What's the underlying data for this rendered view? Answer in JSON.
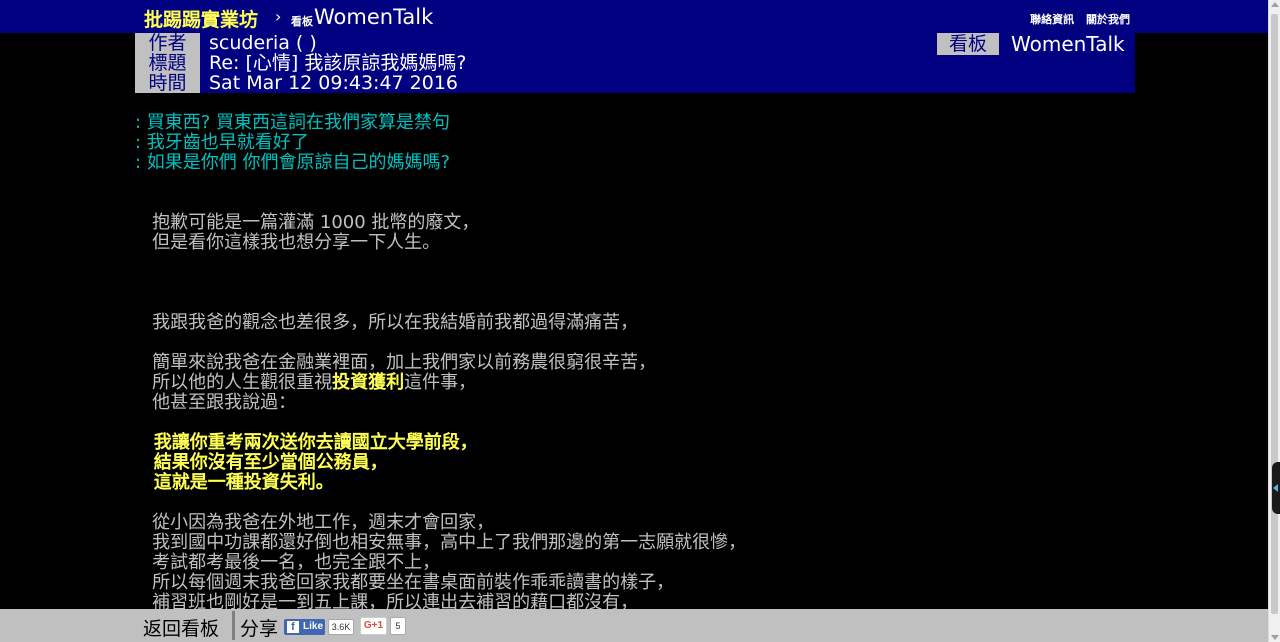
{
  "topbar": {
    "site_title": "批踢踢實業坊",
    "separator": "›",
    "board_small_label": "看板",
    "board_name": "WomenTalk",
    "links": [
      "聯絡資訊",
      "關於我們"
    ]
  },
  "article": {
    "meta": {
      "author_label": "作者",
      "author": "scuderia ( )",
      "title_label": "標題",
      "title": "Re: [心情] 我該原諒我媽媽嗎?",
      "time_label": "時間",
      "time": "Sat Mar 12 09:43:47 2016",
      "board_label": "看板",
      "board": "WomenTalk"
    },
    "lines": [
      {
        "type": "quote",
        "text": ": 買東西? 買東西這詞在我們家算是禁句"
      },
      {
        "type": "quote",
        "text": ": 我牙齒也早就看好了"
      },
      {
        "type": "quote",
        "text": ": 如果是你們 你們會原諒自己的媽媽嗎?"
      },
      {
        "type": "normal",
        "text": ""
      },
      {
        "type": "normal",
        "text": ""
      },
      {
        "type": "normal",
        "text": "   抱歉可能是一篇灌滿 1000 批幣的廢文，"
      },
      {
        "type": "normal",
        "text": "   但是看你這樣我也想分享一下人生。"
      },
      {
        "type": "normal",
        "text": ""
      },
      {
        "type": "normal",
        "text": ""
      },
      {
        "type": "normal",
        "text": ""
      },
      {
        "type": "normal",
        "text": "   我跟我爸的觀念也差很多，所以在我結婚前我都過得滿痛苦，"
      },
      {
        "type": "normal",
        "text": ""
      },
      {
        "type": "normal",
        "text": "   簡單來說我爸在金融業裡面，加上我們家以前務農很窮很辛苦，"
      },
      {
        "type": "mixed",
        "before": "   所以他的人生觀很重視",
        "highlight": "投資獲利",
        "after": "這件事，"
      },
      {
        "type": "normal",
        "text": "   他甚至跟我說過："
      },
      {
        "type": "normal",
        "text": ""
      },
      {
        "type": "highlight",
        "text": "   我讓你重考兩次送你去讀國立大學前段，"
      },
      {
        "type": "highlight",
        "text": "   結果你沒有至少當個公務員，"
      },
      {
        "type": "highlight",
        "text": "   這就是一種投資失利。"
      },
      {
        "type": "normal",
        "text": ""
      },
      {
        "type": "normal",
        "text": "   從小因為我爸在外地工作，週末才會回家，"
      },
      {
        "type": "normal",
        "text": "   我到國中功課都還好倒也相安無事，高中上了我們那邊的第一志願就很慘，"
      },
      {
        "type": "normal",
        "text": "   考試都考最後一名，也完全跟不上，"
      },
      {
        "type": "normal",
        "text": "   所以每個週末我爸回家我都要坐在書桌面前裝作乖乖讀書的樣子，"
      },
      {
        "type": "normal",
        "text": "   補習班也剛好是一到五上課，所以連出去補習的藉口都沒有，"
      }
    ]
  },
  "bottombar": {
    "back_label": "返回看板",
    "share_label": "分享",
    "fb_like_label": "Like",
    "fb_count": "3.6K",
    "gplus_label": "G+1",
    "gplus_count": "5"
  },
  "colors": {
    "header_bg": "#000080",
    "quote": "#00c0c0",
    "text": "#c0c0c0",
    "highlight": "#ffff55",
    "footer_bg": "#c0c0c0"
  }
}
